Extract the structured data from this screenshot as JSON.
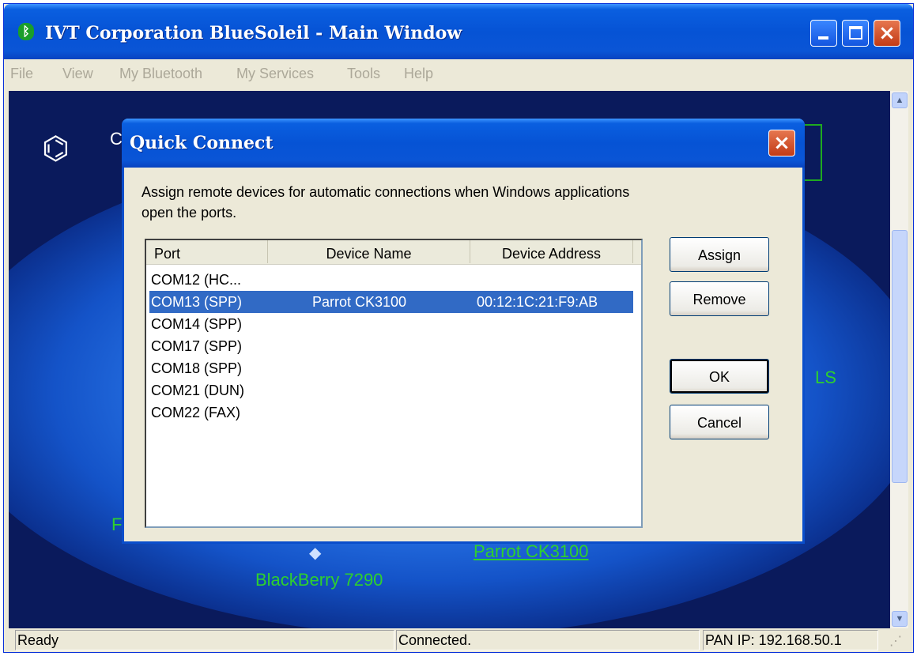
{
  "window": {
    "title": "IVT Corporation BlueSoleil - Main Window",
    "icon": "bluetooth-icon"
  },
  "menu": {
    "items": [
      "File",
      "View",
      "My Bluetooth",
      "My Services",
      "Tools",
      "Help"
    ]
  },
  "background": {
    "device_blackberry": "BlackBerry 7290",
    "device_parrot": "Parrot CK3100"
  },
  "status": {
    "ready": "Ready",
    "connected": "Connected.",
    "pan_ip": "PAN IP: 192.168.50.1"
  },
  "dialog": {
    "title": "Quick Connect",
    "description": "Assign remote devices for automatic connections when Windows applications open the ports.",
    "columns": [
      "Port",
      "Device Name",
      "Device Address"
    ],
    "rows": [
      {
        "port": "COM12 (HC...",
        "name": "",
        "address": ""
      },
      {
        "port": "COM13 (SPP)",
        "name": "Parrot CK3100",
        "address": "00:12:1C:21:F9:AB",
        "selected": true
      },
      {
        "port": "COM14 (SPP)",
        "name": "",
        "address": ""
      },
      {
        "port": "COM17 (SPP)",
        "name": "",
        "address": ""
      },
      {
        "port": "COM18 (SPP)",
        "name": "",
        "address": ""
      },
      {
        "port": "COM21 (DUN)",
        "name": "",
        "address": ""
      },
      {
        "port": "COM22 (FAX)",
        "name": "",
        "address": ""
      }
    ],
    "buttons": {
      "assign": "Assign",
      "remove": "Remove",
      "ok": "OK",
      "cancel": "Cancel"
    }
  }
}
